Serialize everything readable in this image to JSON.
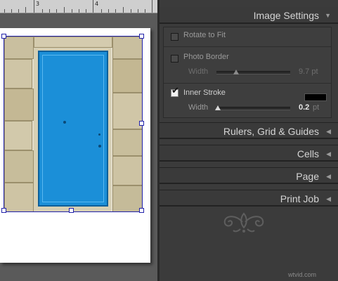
{
  "ruler": {
    "marks": [
      "3",
      "4"
    ]
  },
  "panel": {
    "image_settings": {
      "title": "Image Settings",
      "rotate_to_fit": {
        "label": "Rotate to Fit",
        "checked": false
      },
      "photo_border": {
        "label": "Photo Border",
        "checked": false,
        "width_label": "Width",
        "width_value": "9.7 pt",
        "slider_fraction": 0.27
      },
      "inner_stroke": {
        "label": "Inner Stroke",
        "checked": true,
        "color": "#000000",
        "width_label": "Width",
        "width_value": "0.2",
        "width_unit": "pt",
        "slider_fraction": 0.02
      }
    },
    "sections": [
      {
        "title": "Rulers, Grid & Guides"
      },
      {
        "title": "Cells"
      },
      {
        "title": "Page"
      },
      {
        "title": "Print Job"
      }
    ]
  },
  "photo": {
    "door_color": "#1b8fd8"
  },
  "watermark": "wtvid.com"
}
